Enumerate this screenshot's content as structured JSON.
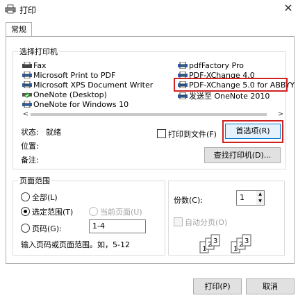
{
  "window": {
    "title": "打印",
    "close_symbol": "✕"
  },
  "tabs": [
    {
      "label": "常规"
    }
  ],
  "printer_group": {
    "legend": "选择打印机",
    "printers_left": [
      {
        "name": "Fax",
        "icon": "fax-icon"
      },
      {
        "name": "Microsoft Print to PDF",
        "icon": "printer-icon"
      },
      {
        "name": "Microsoft XPS Document Writer",
        "icon": "printer-icon"
      },
      {
        "name": "OneNote (Desktop)",
        "icon": "printer-check-icon"
      },
      {
        "name": "OneNote for Windows 10",
        "icon": "printer-icon"
      }
    ],
    "printers_right": [
      {
        "name": "pdfFactory Pro",
        "icon": "printer-icon"
      },
      {
        "name": "PDF-XChange 4.0",
        "icon": "printer-icon"
      },
      {
        "name": "PDF-XChange 5.0 for ABBYY",
        "icon": "printer-icon",
        "selected": true
      },
      {
        "name": "发送至 OneNote 2010",
        "icon": "printer-icon"
      }
    ],
    "status_label": "状态:",
    "status_value": "就绪",
    "location_label": "位置:",
    "comment_label": "备注:",
    "print_to_file_label": "打印到文件(F)",
    "preferences_button": "首选项(R)",
    "find_printer_button": "查找打印机(D)..."
  },
  "page_range": {
    "legend": "页面范围",
    "all_label": "全部(L)",
    "selection_label": "选定范围(T)",
    "current_page_label": "当前页面(U)",
    "pages_label": "页码(G):",
    "pages_value": "1-4",
    "hint": "输入页码或页面范围。如，5-12"
  },
  "copies": {
    "label": "份数(C):",
    "value": "1",
    "collate_label": "自动分页(O)"
  },
  "footer": {
    "print_button": "打印(P)",
    "cancel_button": "取消"
  },
  "colors": {
    "highlight": "#d02020",
    "focus": "#0078d7"
  }
}
